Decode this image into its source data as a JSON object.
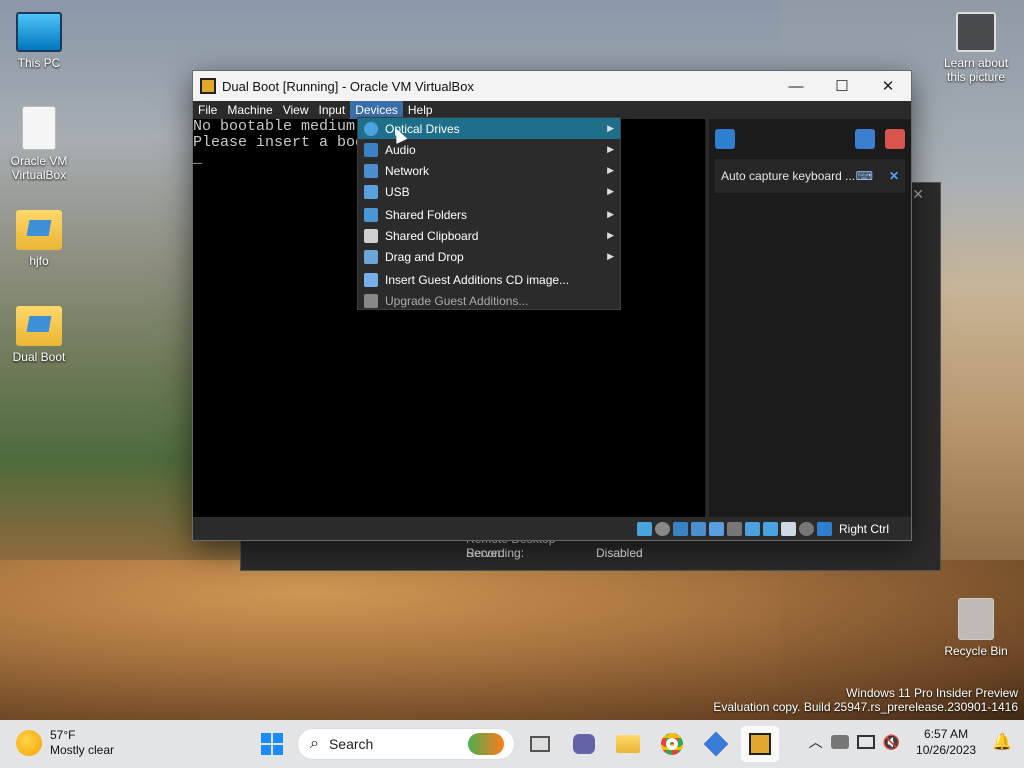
{
  "desktop": {
    "icons": [
      {
        "label": "This PC"
      },
      {
        "label": "Oracle VM VirtualBox"
      },
      {
        "label": "hjfo"
      },
      {
        "label": "Dual Boot"
      }
    ],
    "learn_about": "Learn about this picture",
    "recycle_bin": "Recycle Bin"
  },
  "bg_window": {
    "rows": [
      {
        "key": "Remote Desktop Server:",
        "value": "Disabled"
      },
      {
        "key": "Recording:",
        "value": "Disabled"
      }
    ]
  },
  "vbox": {
    "title": "Dual Boot [Running] - Oracle VM VirtualBox",
    "menu": [
      "File",
      "Machine",
      "View",
      "Input",
      "Devices",
      "Help"
    ],
    "active_menu": "Devices",
    "screen_lines": [
      "No bootable medium",
      "Please insert a boo",
      "_"
    ],
    "notification": "Auto capture keyboard ...",
    "host_key": "Right Ctrl"
  },
  "devices_menu": {
    "items": [
      {
        "label": "Optical Drives",
        "submenu": true,
        "selected": true,
        "icon": "optical-drive-icon",
        "color": "#4aa3df"
      },
      {
        "label": "Audio",
        "submenu": true,
        "icon": "audio-icon",
        "color": "#3b82c4"
      },
      {
        "label": "Network",
        "submenu": true,
        "icon": "network-icon",
        "color": "#4b8fd1"
      },
      {
        "label": "USB",
        "submenu": true,
        "icon": "usb-icon",
        "color": "#5aa0e0"
      },
      {
        "label": "Shared Folders",
        "submenu": true,
        "icon": "shared-folders-icon",
        "color": "#4b97d6"
      },
      {
        "label": "Shared Clipboard",
        "submenu": true,
        "icon": "clipboard-icon",
        "color": "#d0d0d0"
      },
      {
        "label": "Drag and Drop",
        "submenu": true,
        "icon": "drag-drop-icon",
        "color": "#6aa6d8"
      },
      {
        "label": "Insert Guest Additions CD image...",
        "submenu": false,
        "icon": "guest-additions-icon",
        "color": "#7ab0e8"
      },
      {
        "label": "Upgrade Guest Additions...",
        "submenu": false,
        "disabled": true,
        "icon": "upgrade-icon",
        "color": "#888888"
      }
    ]
  },
  "watermark": {
    "line1": "Windows 11 Pro Insider Preview",
    "line2": "Evaluation copy. Build 25947.rs_prerelease.230901-1416"
  },
  "taskbar": {
    "weather_temp": "57°F",
    "weather_desc": "Mostly clear",
    "search_placeholder": "Search",
    "time": "6:57 AM",
    "date": "10/26/2023"
  },
  "colors": {
    "accent": "#1f6f8b",
    "menu_bg": "#2b2b2b"
  }
}
